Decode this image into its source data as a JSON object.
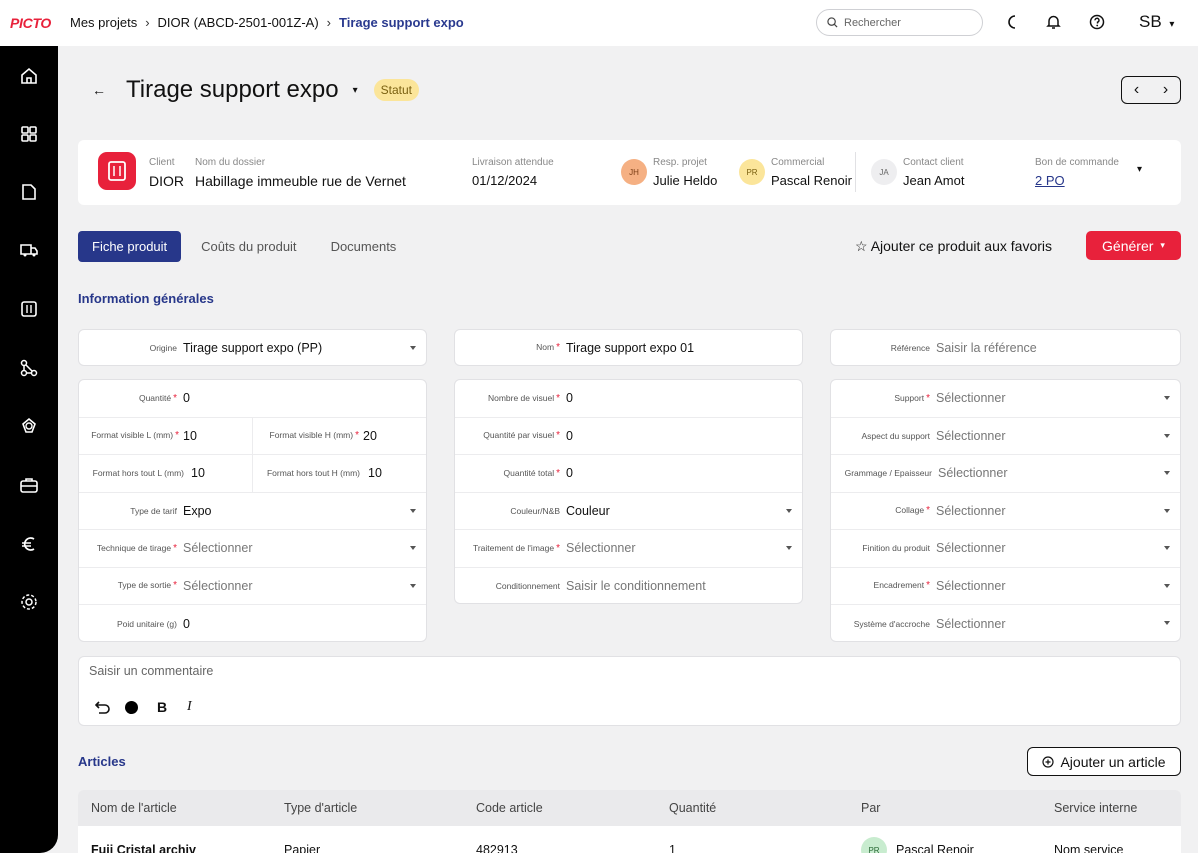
{
  "app": {
    "logo": "PICTO"
  },
  "breadcrumb": {
    "items": [
      "Mes projets",
      "DIOR (ABCD-2501-001Z-A)",
      "Tirage support expo"
    ]
  },
  "search": {
    "placeholder": "Rechercher"
  },
  "user": {
    "initials": "SB"
  },
  "page": {
    "title": "Tirage support expo",
    "status": "Statut"
  },
  "info": {
    "client_label": "Client",
    "client": "DIOR",
    "dossier_label": "Nom du dossier",
    "dossier": "Habillage immeuble rue de Vernet",
    "livraison_label": "Livraison attendue",
    "livraison": "01/12/2024",
    "resp_label": "Resp. projet",
    "resp": "Julie Heldo",
    "resp_initials": "JH",
    "com_label": "Commercial",
    "com": "Pascal Renoir",
    "com_initials": "PR",
    "contact_label": "Contact client",
    "contact": "Jean Amot",
    "contact_initials": "JA",
    "bdc_label": "Bon de commande",
    "bdc": "2 PO"
  },
  "tabs": [
    "Fiche produit",
    "Coûts du produit",
    "Documents"
  ],
  "actions": {
    "favorite": "Ajouter ce produit aux favoris",
    "generate": "Générer"
  },
  "sections": {
    "general": "Information générales",
    "articles": "Articles"
  },
  "fields": {
    "origine": {
      "label": "Origine",
      "value": "Tirage support expo (PP)"
    },
    "nom": {
      "label": "Nom",
      "value": "Tirage support expo 01"
    },
    "reference": {
      "label": "Référence",
      "placeholder": "Saisir la référence"
    },
    "quantite": {
      "label": "Quantité",
      "value": "0"
    },
    "fvl": {
      "label": "Format visible L (mm)",
      "value": "10"
    },
    "fvh": {
      "label": "Format visible H (mm)",
      "value": "20"
    },
    "fhl": {
      "label": "Format hors tout L (mm)",
      "value": "10"
    },
    "fhh": {
      "label": "Format hors tout H (mm)",
      "value": "10"
    },
    "tarif": {
      "label": "Type de tarif",
      "value": "Expo"
    },
    "technique": {
      "label": "Technique de tirage",
      "value": "Sélectionner"
    },
    "sortie": {
      "label": "Type de sortie",
      "value": "Sélectionner"
    },
    "poids": {
      "label": "Poid unitaire (g)",
      "value": "0"
    },
    "nb_visuel": {
      "label": "Nombre de visuel",
      "value": "0"
    },
    "qte_visuel": {
      "label": "Quantité par visuel",
      "value": "0"
    },
    "qte_total": {
      "label": "Quantité total",
      "value": "0"
    },
    "couleur": {
      "label": "Couleur/N&B",
      "value": "Couleur"
    },
    "traitement": {
      "label": "Traitement de l'image",
      "value": "Sélectionner"
    },
    "conditionnement": {
      "label": "Conditionnement",
      "value": "Saisir le conditionnement"
    },
    "support": {
      "label": "Support",
      "value": "Sélectionner"
    },
    "aspect": {
      "label": "Aspect du support",
      "value": "Sélectionner"
    },
    "grammage": {
      "label": "Grammage / Epaisseur",
      "value": "Sélectionner"
    },
    "collage": {
      "label": "Collage",
      "value": "Sélectionner"
    },
    "finition": {
      "label": "Finition du produit",
      "value": "Sélectionner"
    },
    "encadrement": {
      "label": "Encadrement",
      "value": "Sélectionner"
    },
    "accroche": {
      "label": "Système d'accroche",
      "value": "Sélectionner"
    }
  },
  "comment": {
    "placeholder": "Saisir un commentaire"
  },
  "articles": {
    "add": "Ajouter un article",
    "columns": [
      "Nom de l'article",
      "Type d'article",
      "Code article",
      "Quantité",
      "Par",
      "Service interne"
    ],
    "rows": [
      {
        "nom": "Fuji Cristal archiv",
        "type": "Papier",
        "code": "482913",
        "qte": "1",
        "par": "Pascal Renoir",
        "par_initials": "PR",
        "service": "Nom service"
      }
    ]
  },
  "colors": {
    "brand": "#e8213b",
    "primary": "#27378a",
    "status": "#fbe59a"
  }
}
